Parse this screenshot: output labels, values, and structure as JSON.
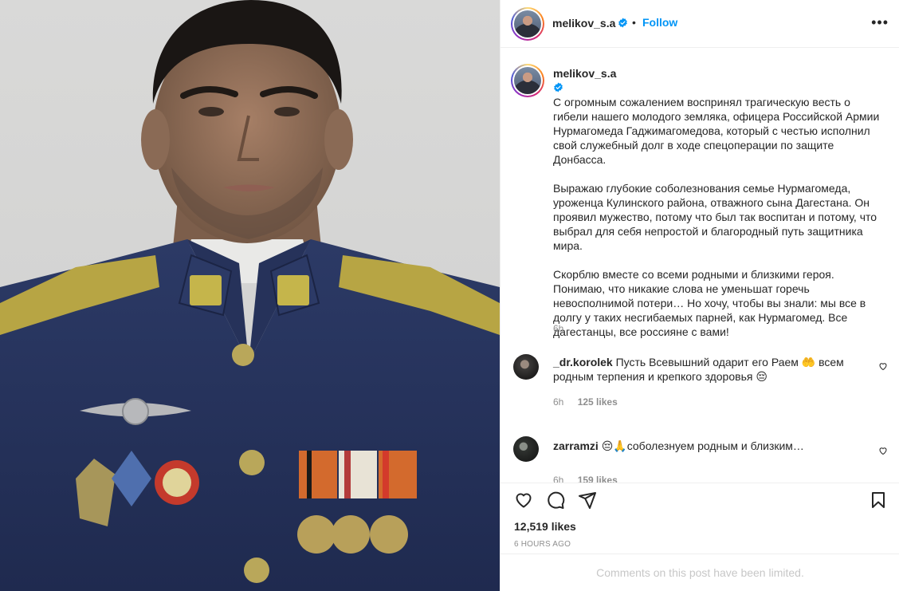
{
  "post": {
    "username": "melikov_s.a",
    "follow_label": "Follow",
    "dot": "•",
    "more_label": "•••",
    "caption_paragraphs": [
      "С огромным сожалением воспринял трагическую весть о гибели нашего молодого земляка, офицера Российской Армии Нурмагомеда Гаджимагомедова, который с честью исполнил свой служебный долг в ходе спецоперации по защите Донбасса.",
      "Выражаю глубокие соболезнования семье Нурмагомеда, уроженца Кулинского района, отважного сына Дагестана. Он проявил мужество, потому что был так воспитан и потому, что выбрал для себя непростой и благородный путь защитника мира.",
      "Скорблю вместе со всеми родными и близкими героя. Понимаю, что никакие слова не уменьшат горечь невосполнимой потери… Но хочу, чтобы вы знали: мы все в долгу у таких несгибаемых парней, как Нурмагомед. Все дагестанцы, все россияне с вами!"
    ],
    "caption_time": "6h",
    "likes": "12,519 likes",
    "posted": "6 HOURS AGO",
    "comments_limited": "Comments on this post have been limited."
  },
  "comments": [
    {
      "username": "_dr.korolek",
      "text": "Пусть Всевышний одарит его Раем 🤲 всем родным терпения и крепкого здоровья 😔",
      "time": "6h",
      "likes": "125 likes"
    },
    {
      "username": "zarramzi",
      "text": "😔🙏соболезнуем родным и близким…",
      "time": "6h",
      "likes": "159 likes"
    }
  ],
  "colors": {
    "accent": "#0095f6",
    "verified": "#0095f6",
    "text": "#262626",
    "muted": "#8e8e8e"
  },
  "icons": [
    "verified-badge-icon",
    "more-icon",
    "heart-icon",
    "comment-icon",
    "share-icon",
    "bookmark-icon"
  ]
}
